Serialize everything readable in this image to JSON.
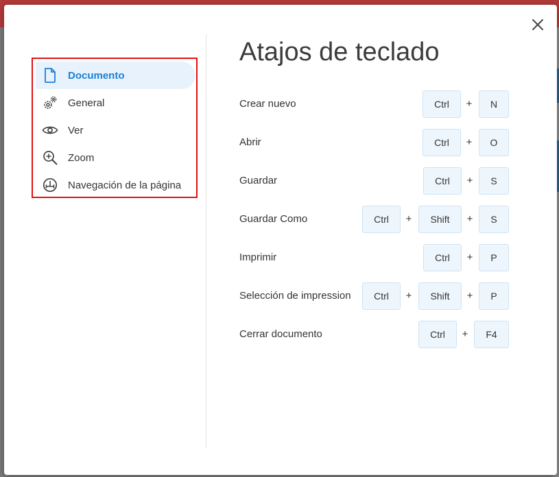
{
  "dialog": {
    "title": "Atajos de teclado",
    "close_label": "×"
  },
  "nav": {
    "items": [
      {
        "label": "Documento",
        "icon": "document-icon",
        "active": true
      },
      {
        "label": "General",
        "icon": "gears-icon",
        "active": false
      },
      {
        "label": "Ver",
        "icon": "eye-icon",
        "active": false
      },
      {
        "label": "Zoom",
        "icon": "zoom-in-icon",
        "active": false
      },
      {
        "label": "Navegación de la página",
        "icon": "page-navigation-icon",
        "active": false
      }
    ]
  },
  "shortcuts": [
    {
      "label": "Crear nuevo",
      "keys": [
        "Ctrl",
        "N"
      ]
    },
    {
      "label": "Abrir",
      "keys": [
        "Ctrl",
        "O"
      ]
    },
    {
      "label": "Guardar",
      "keys": [
        "Ctrl",
        "S"
      ]
    },
    {
      "label": "Guardar Como",
      "keys": [
        "Ctrl",
        "Shift",
        "S"
      ]
    },
    {
      "label": "Imprimir",
      "keys": [
        "Ctrl",
        "P"
      ]
    },
    {
      "label": "Selección de impression",
      "keys": [
        "Ctrl",
        "Shift",
        "P"
      ]
    },
    {
      "label": "Cerrar documento",
      "keys": [
        "Ctrl",
        "F4"
      ]
    }
  ],
  "plus_sign": "+",
  "colors": {
    "accent": "#1a7fd6",
    "active_bg": "#e8f2fc",
    "highlight_border": "#e01010",
    "key_bg": "#eef6fd"
  }
}
